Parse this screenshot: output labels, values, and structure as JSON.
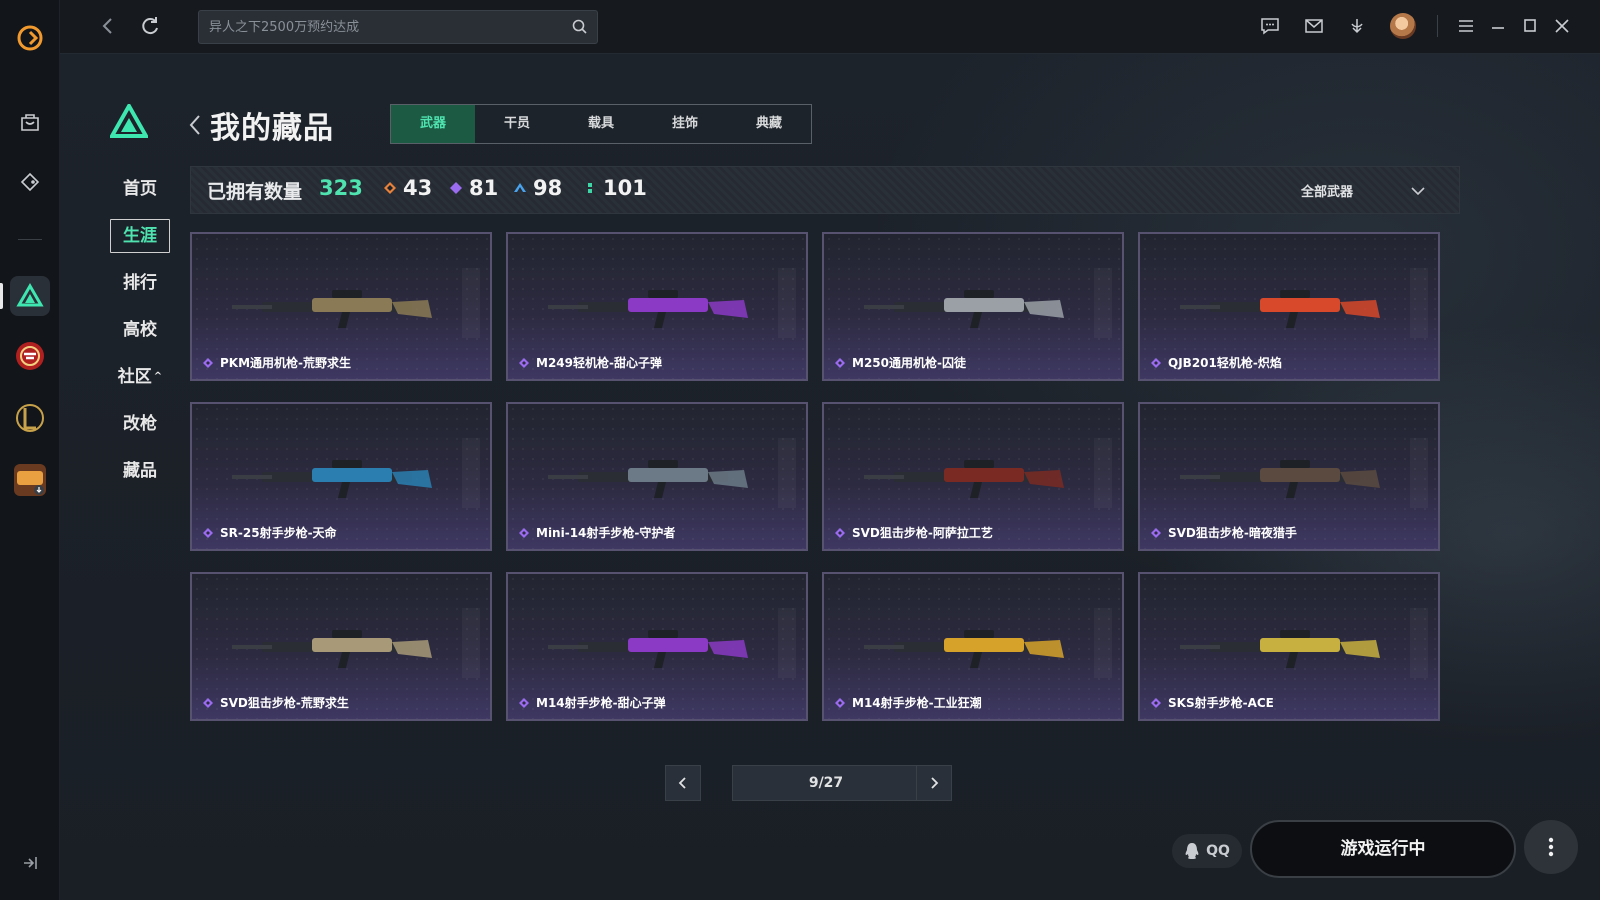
{
  "topbar": {
    "search_placeholder": "异人之下2500万预约达成"
  },
  "sidebar_nav": {
    "items": [
      {
        "label": "首页"
      },
      {
        "label": "生涯"
      },
      {
        "label": "排行"
      },
      {
        "label": "高校"
      },
      {
        "label": "社区"
      },
      {
        "label": "改枪"
      },
      {
        "label": "藏品"
      }
    ],
    "active": "生涯",
    "community_caret": "^"
  },
  "page": {
    "title": "我的藏品",
    "tabs": [
      "武器",
      "干员",
      "载具",
      "挂饰",
      "典藏"
    ],
    "active_tab": "武器"
  },
  "stats": {
    "owned_label": "已拥有数量",
    "owned_total": "323",
    "rarity_counts": [
      {
        "value": "43",
        "color": "#e8813a"
      },
      {
        "value": "81",
        "color": "#9b6cf0"
      },
      {
        "value": "98",
        "color": "#4aa3f0"
      },
      {
        "value": "101",
        "color": "#3ed6a6"
      }
    ],
    "filter_label": "全部武器"
  },
  "items": [
    {
      "name": "PKM通用机枪-荒野求生",
      "accent": "#8a7a55"
    },
    {
      "name": "M249轻机枪-甜心子弹",
      "accent": "#8a3ac4"
    },
    {
      "name": "M250通用机枪-囚徒",
      "accent": "#9aa0a6"
    },
    {
      "name": "QJB201轻机枪-炽焰",
      "accent": "#d8482a"
    },
    {
      "name": "SR-25射手步枪-天命",
      "accent": "#2a7fb0"
    },
    {
      "name": "Mini-14射手步枪-守护者",
      "accent": "#6b7a86"
    },
    {
      "name": "SVD狙击步枪-阿萨拉工艺",
      "accent": "#7a2a22"
    },
    {
      "name": "SVD狙击步枪-暗夜猎手",
      "accent": "#5a4a40"
    },
    {
      "name": "SVD狙击步枪-荒野求生",
      "accent": "#a89a78"
    },
    {
      "name": "M14射手步枪-甜心子弹",
      "accent": "#8a3ac4"
    },
    {
      "name": "M14射手步枪-工业狂潮",
      "accent": "#d6a22a"
    },
    {
      "name": "SKS射手步枪-ACE",
      "accent": "#c8b040"
    }
  ],
  "rarity_icon_color": "#9b6cf0",
  "pagination": {
    "current": "9/27"
  },
  "footer": {
    "qq_label": "QQ",
    "launch_label": "游戏运行中"
  },
  "colors": {
    "accent_green": "#4fe3b0",
    "card_border": "#565270"
  }
}
